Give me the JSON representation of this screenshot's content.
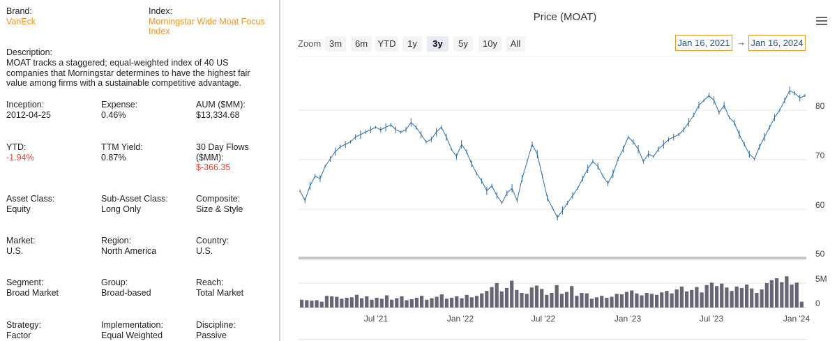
{
  "fund": {
    "brand_label": "Brand:",
    "brand_value": "VanEck",
    "index_label": "Index:",
    "index_value_line1": "Morningstar Wide Moat Focus",
    "index_value_line2": "Index",
    "description_label": "Description:",
    "description_text": "MOAT tracks a staggered; equal-weighted index of 40 US companies that Morningstar determines to have the highest fair value among firms with a sustainable competitive advantage.",
    "inception_label": "Inception:",
    "inception_value": "2012-04-25",
    "expense_label": "Expense:",
    "expense_value": "0.46%",
    "aum_label": "AUM ($MM):",
    "aum_value": "$13,334.68",
    "ytd_label": "YTD:",
    "ytd_value": "-1.94%",
    "ttm_label": "TTM Yield:",
    "ttm_value": "0.87%",
    "flows_label_line1": "30 Day Flows",
    "flows_label_line2": "($MM):",
    "flows_value": "$-366.35",
    "asset_class_label": "Asset Class:",
    "asset_class_value": "Equity",
    "sub_asset_label": "Sub-Asset Class:",
    "sub_asset_value": "Long Only",
    "composite_label": "Composite:",
    "composite_value": "Size & Style",
    "market_label": "Market:",
    "market_value": "U.S.",
    "region_label": "Region:",
    "region_value": "North America",
    "country_label": "Country:",
    "country_value": "U.S.",
    "segment_label": "Segment:",
    "segment_value": "Broad Market",
    "group_label": "Group:",
    "group_value": "Broad-based",
    "reach_label": "Reach:",
    "reach_value": "Total Market",
    "strategy_label": "Strategy:",
    "strategy_value": "Factor",
    "implementation_label": "Implementation:",
    "implementation_value": "Equal Weighted",
    "discipline_label": "Discipline:",
    "discipline_value": "Passive"
  },
  "chart": {
    "title": "Price (MOAT)",
    "zoom_label": "Zoom",
    "zoom_buttons": [
      "3m",
      "6m",
      "YTD",
      "1y",
      "3y",
      "5y",
      "10y",
      "All"
    ],
    "active_zoom": "3y",
    "range_from": "Jan 16, 2021",
    "range_to": "Jan 16, 2024",
    "range_arrow": "→",
    "colors": {
      "price": "#2e6da4",
      "volume": "#666677",
      "accent": "#e8952a",
      "red": "#e8413a"
    }
  },
  "chart_data": {
    "type": "line",
    "x_ticks": [
      "Jul '21",
      "Jan '22",
      "Jul '22",
      "Jan '23",
      "Jul '23",
      "Jan '24"
    ],
    "price_axis_ticks": [
      "80",
      "70",
      "60",
      "50"
    ],
    "volume_axis_ticks": [
      "5M",
      "0"
    ],
    "ylim": [
      50,
      90
    ],
    "series": [
      {
        "values": [
          63.5,
          61.5,
          64.5,
          66.5,
          66.0,
          68.5,
          70.0,
          71.5,
          72.5,
          73.0,
          73.5,
          74.5,
          75.0,
          75.5,
          76.0,
          76.5,
          76.0,
          76.5,
          77.0,
          76.0,
          75.5,
          76.0,
          77.5,
          76.5,
          75.0,
          73.5,
          74.0,
          75.5,
          76.5,
          74.5,
          72.0,
          70.5,
          73.0,
          71.5,
          69.0,
          67.0,
          65.5,
          63.5,
          64.5,
          62.5,
          61.0,
          63.0,
          64.0,
          61.5,
          66.0,
          69.5,
          73.0,
          71.0,
          66.5,
          62.0,
          60.0,
          58.0,
          59.5,
          61.0,
          62.5,
          64.0,
          66.0,
          68.0,
          69.5,
          68.5,
          66.5,
          65.0,
          67.0,
          70.0,
          72.0,
          74.5,
          73.5,
          72.0,
          69.5,
          71.0,
          70.5,
          72.0,
          73.0,
          74.0,
          74.5,
          75.0,
          76.0,
          77.5,
          79.0,
          81.0,
          82.0,
          83.0,
          82.0,
          79.5,
          81.0,
          78.5,
          77.5,
          75.0,
          73.0,
          71.0,
          70.0,
          72.5,
          74.5,
          76.5,
          78.5,
          80.0,
          82.0,
          84.0,
          83.5,
          82.5,
          83.0
        ],
        "volumes": [
          1.6,
          1.5,
          1.4,
          1.5,
          1.2,
          2.4,
          2.3,
          2.2,
          1.8,
          2.0,
          2.1,
          2.6,
          1.9,
          2.3,
          1.6,
          2.0,
          1.8,
          2.5,
          1.6,
          1.9,
          2.3,
          1.5,
          1.7,
          2.0,
          2.4,
          1.6,
          1.9,
          2.2,
          2.7,
          1.8,
          2.0,
          2.3,
          1.9,
          2.6,
          2.1,
          2.4,
          2.9,
          3.4,
          4.2,
          5.0,
          3.3,
          4.0,
          5.5,
          3.6,
          3.0,
          2.8,
          4.1,
          4.5,
          3.8,
          2.6,
          3.0,
          4.6,
          2.8,
          3.2,
          4.4,
          2.4,
          3.0,
          2.9,
          1.8,
          2.1,
          2.4,
          2.0,
          2.2,
          2.8,
          2.7,
          3.2,
          3.5,
          2.9,
          2.5,
          3.0,
          2.8,
          2.6,
          3.1,
          3.4,
          2.9,
          3.7,
          4.3,
          3.3,
          3.6,
          4.2,
          3.1,
          4.6,
          5.1,
          4.4,
          4.9,
          4.1,
          3.4,
          4.3,
          4.0,
          4.7,
          3.9,
          3.0,
          3.7,
          5.0,
          5.6,
          6.0,
          5.2,
          6.4,
          4.7,
          5.1,
          1.2
        ]
      }
    ]
  }
}
